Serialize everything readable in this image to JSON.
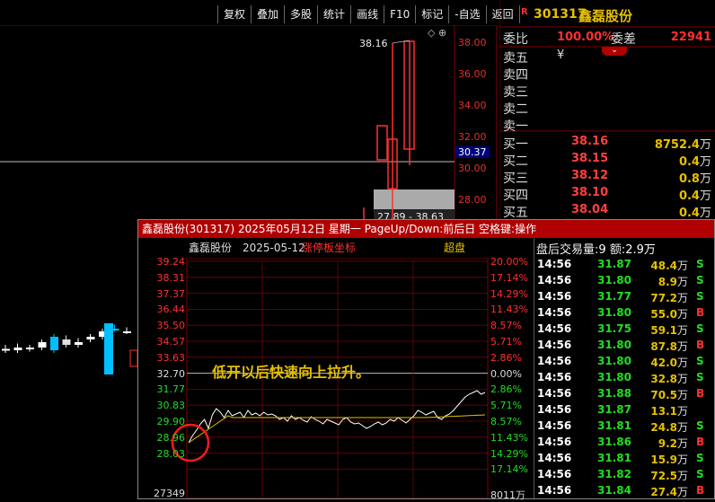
{
  "toolbar": {
    "buttons": [
      "复权",
      "叠加",
      "多股",
      "统计",
      "画线",
      "F10",
      "标记",
      "-自选",
      "返回"
    ]
  },
  "main_chart": {
    "y_ticks": [
      "38.00",
      "36.00",
      "34.00",
      "32.00",
      "30.00",
      "28.00"
    ],
    "high_label": "38.16",
    "current_price": "30.37",
    "range_label": "27.89 - 38.63",
    "candles": [
      {
        "o": 31.0,
        "c": 31.05,
        "h": 31.2,
        "l": 30.9,
        "color": "#fff"
      },
      {
        "o": 31.0,
        "c": 31.1,
        "h": 31.25,
        "l": 30.9,
        "color": "#fff"
      },
      {
        "o": 31.1,
        "c": 31.05,
        "h": 31.2,
        "l": 30.95,
        "color": "#fff"
      },
      {
        "o": 31.1,
        "c": 31.3,
        "h": 31.4,
        "l": 31.0,
        "color": "#fff"
      },
      {
        "o": 31.0,
        "c": 31.5,
        "h": 31.6,
        "l": 30.9,
        "color": "#00bfff"
      },
      {
        "o": 31.2,
        "c": 31.4,
        "h": 31.55,
        "l": 31.1,
        "color": "#e0e0e0"
      },
      {
        "o": 31.2,
        "c": 31.3,
        "h": 31.45,
        "l": 31.1,
        "color": "#fff"
      },
      {
        "o": 31.4,
        "c": 31.5,
        "h": 31.6,
        "l": 31.3,
        "color": "#fff"
      },
      {
        "o": 31.5,
        "c": 31.7,
        "h": 31.8,
        "l": 31.4,
        "color": "#fff"
      },
      {
        "o": 31.8,
        "c": 31.8,
        "h": 31.95,
        "l": 31.7,
        "color": "#00bfff"
      },
      {
        "o": 31.7,
        "c": 31.7,
        "h": 31.85,
        "l": 31.6,
        "color": "#fff"
      }
    ]
  },
  "right_panel": {
    "code": "301317",
    "name": "鑫磊股份",
    "r_mark": "R",
    "commit_ratio_label": "委比",
    "commit_ratio": "100.00%",
    "commit_diff_label": "委差",
    "commit_diff": "22941",
    "sells": [
      {
        "label": "卖五",
        "extra": "¥"
      },
      {
        "label": "卖四"
      },
      {
        "label": "卖三"
      },
      {
        "label": "卖二"
      },
      {
        "label": "卖一"
      }
    ],
    "buys": [
      {
        "label": "买一",
        "price": "38.16",
        "vol": "8752.4",
        "unit": "万"
      },
      {
        "label": "买二",
        "price": "38.15",
        "vol": "0.4",
        "unit": "万"
      },
      {
        "label": "买三",
        "price": "38.12",
        "vol": "0.8",
        "unit": "万"
      },
      {
        "label": "买四",
        "price": "38.10",
        "vol": "0.4",
        "unit": "万"
      },
      {
        "label": "买五",
        "price": "38.04",
        "vol": "0.4",
        "unit": "万"
      }
    ]
  },
  "popup": {
    "title": "鑫磊股份(301317) 2025年05月12日 星期一 PageUp/Down:前后日 空格键:操作",
    "sub_name": "鑫磊股份",
    "sub_date": "2025-05-12",
    "sub_mode": "涨停板坐标",
    "sub_right": "超盘",
    "annotation": "低开以后快速向上拉升。",
    "left_ticks": [
      "39.24",
      "38.31",
      "37.37",
      "36.44",
      "35.50",
      "34.57",
      "33.63",
      "32.70",
      "31.77",
      "30.83",
      "29.90",
      "28.96",
      "28.03",
      "27349"
    ],
    "right_ticks": [
      "20.00%",
      "17.14%",
      "14.29%",
      "11.43%",
      "8.57%",
      "5.71%",
      "2.86%",
      "0.00%",
      "2.86%",
      "5.71%",
      "8.57%",
      "11.43%",
      "14.29%",
      "17.14%",
      "8011万"
    ],
    "header_left": "盘后交易量",
    "header_count": "9",
    "header_amt_label": "额",
    "header_amt": "2.9万",
    "trades": [
      {
        "t": "14:56",
        "p": "31.87",
        "v": "48.4",
        "u": "万",
        "s": "S"
      },
      {
        "t": "14:56",
        "p": "31.80",
        "v": "8.9",
        "u": "万",
        "s": "S"
      },
      {
        "t": "14:56",
        "p": "31.77",
        "v": "77.2",
        "u": "万",
        "s": "S"
      },
      {
        "t": "14:56",
        "p": "31.80",
        "v": "55.0",
        "u": "万",
        "s": "B"
      },
      {
        "t": "14:56",
        "p": "31.75",
        "v": "59.1",
        "u": "万",
        "s": "S"
      },
      {
        "t": "14:56",
        "p": "31.80",
        "v": "87.8",
        "u": "万",
        "s": "B"
      },
      {
        "t": "14:56",
        "p": "31.80",
        "v": "42.0",
        "u": "万",
        "s": "S"
      },
      {
        "t": "14:56",
        "p": "31.80",
        "v": "32.8",
        "u": "万",
        "s": "S"
      },
      {
        "t": "14:56",
        "p": "31.88",
        "v": "70.5",
        "u": "万",
        "s": "B"
      },
      {
        "t": "14:56",
        "p": "31.87",
        "v": "13.1",
        "u": "万",
        "s": ""
      },
      {
        "t": "14:56",
        "p": "31.81",
        "v": "24.8",
        "u": "万",
        "s": "S"
      },
      {
        "t": "14:56",
        "p": "31.86",
        "v": "9.2",
        "u": "万",
        "s": "B"
      },
      {
        "t": "14:56",
        "p": "31.81",
        "v": "15.9",
        "u": "万",
        "s": "S"
      },
      {
        "t": "14:56",
        "p": "31.82",
        "v": "72.5",
        "u": "万",
        "s": "S"
      },
      {
        "t": "14:56",
        "p": "31.84",
        "v": "27.4",
        "u": "万",
        "s": "B"
      }
    ],
    "colors": {
      "buy": "#ff3030",
      "sell": "#22dd22",
      "accent": "#e6c000"
    }
  }
}
